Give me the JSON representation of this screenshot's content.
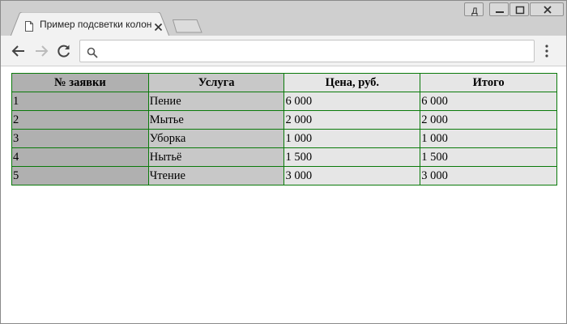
{
  "window": {
    "controls": [
      "user-badge-icon",
      "minimize-icon",
      "restore-icon",
      "close-icon"
    ],
    "user_badge_label": "Д"
  },
  "tab": {
    "title": "Пример подсветки колонок",
    "icon": "page-icon",
    "close_icon": "close-icon"
  },
  "toolbar": {
    "back_icon": "arrow-left-icon",
    "forward_icon": "arrow-right-icon",
    "reload_icon": "reload-icon",
    "menu_icon": "kebab-menu-icon",
    "address_value": ""
  },
  "table": {
    "headers": [
      "№ заявки",
      "Услуга",
      "Цена, руб.",
      "Итого"
    ],
    "rows": [
      [
        "1",
        "Пение",
        "6 000",
        "6 000"
      ],
      [
        "2",
        "Мытье",
        "2 000",
        "2 000"
      ],
      [
        "3",
        "Уборка",
        "1 000",
        "1 000"
      ],
      [
        "4",
        "Нытьё",
        "1 500",
        "1 500"
      ],
      [
        "5",
        "Чтение",
        "3 000",
        "3 000"
      ]
    ],
    "column_colors": [
      "#b0b0b0",
      "#c8c8c8",
      "#e6e6e6",
      "#e6e6e6"
    ],
    "border_color": "#0a7a0a"
  }
}
